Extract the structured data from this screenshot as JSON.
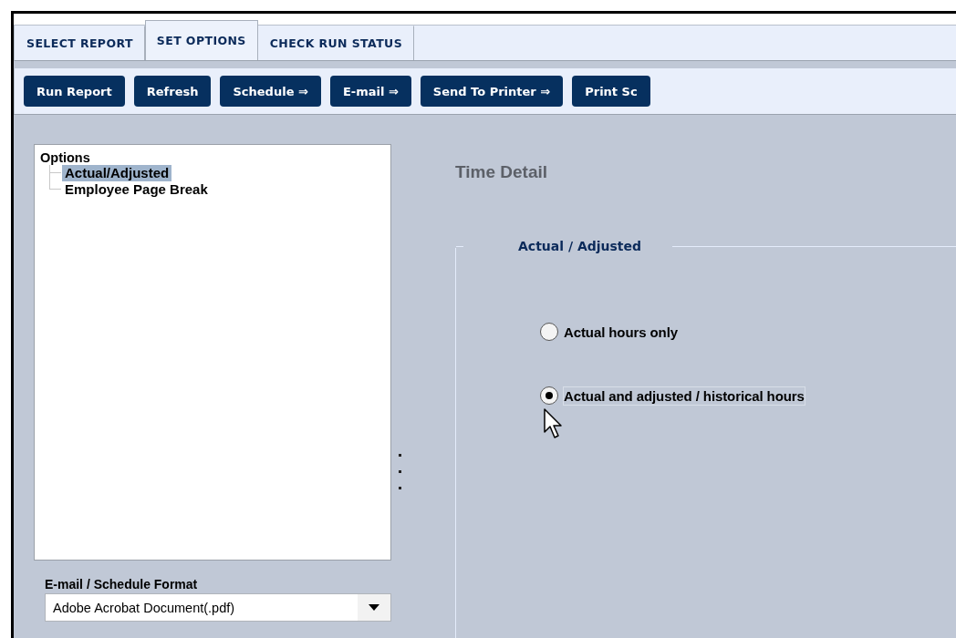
{
  "tabs": [
    {
      "label": "SELECT REPORT",
      "selected": false
    },
    {
      "label": "SET OPTIONS",
      "selected": true
    },
    {
      "label": "CHECK RUN STATUS",
      "selected": false
    }
  ],
  "toolbar": [
    "Run Report",
    "Refresh",
    "Schedule ⇒",
    "E-mail ⇒",
    "Send To Printer ⇒",
    "Print Sc"
  ],
  "tree": {
    "label": "Options",
    "children": [
      {
        "label": "Actual/Adjusted",
        "selected": true
      },
      {
        "label": "Employee Page Break",
        "selected": false
      }
    ]
  },
  "format": {
    "label": "E-mail / Schedule Format",
    "value": "Adobe Acrobat Document(.pdf)"
  },
  "report_title": "Time Detail",
  "group": {
    "legend": "Actual / Adjusted",
    "options": [
      {
        "label": "Actual hours only",
        "selected": false
      },
      {
        "label": "Actual and adjusted / historical hours",
        "selected": true
      }
    ]
  }
}
